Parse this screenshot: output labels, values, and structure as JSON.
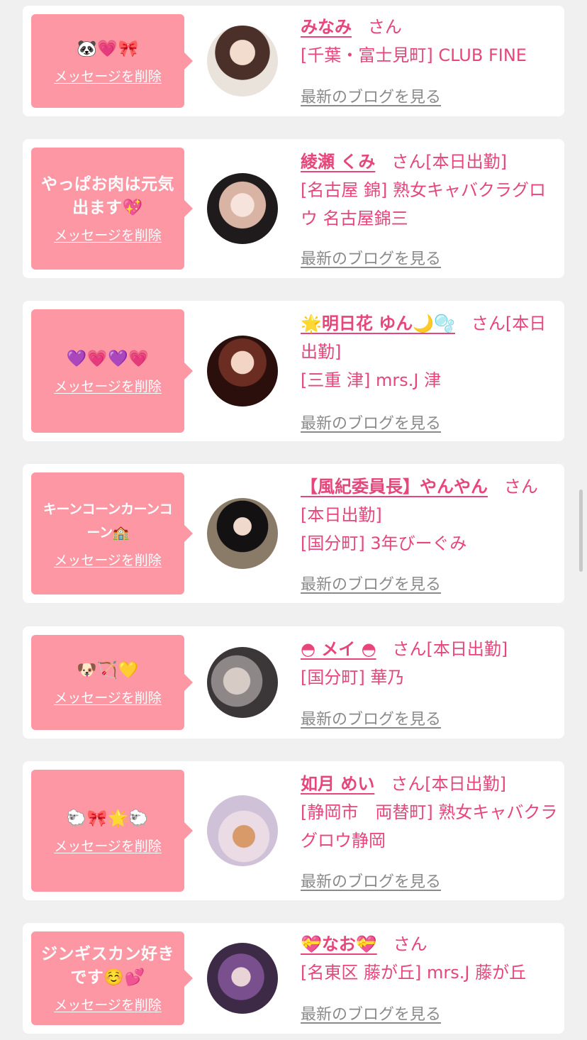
{
  "colors": {
    "bubble": "#fd97a4",
    "accent": "#e6467a",
    "link_gray": "#8a8a8a",
    "background": "#f0f0f0"
  },
  "entries": [
    {
      "message": "🐼💗🎀",
      "delete_label": "メッセージを削除",
      "name": "みなみ",
      "suffix": "さん",
      "status": "",
      "shop": "[千葉・富士見町] CLUB FINE",
      "blog_link": "最新のブログを見る"
    },
    {
      "message": "やっぱお肉は元気出ます💖",
      "delete_label": "メッセージを削除",
      "name": "綾瀬 くみ",
      "suffix": "さん",
      "status": "[本日出勤]",
      "shop": "[名古屋 錦] 熟女キャバクラグロウ 名古屋錦三",
      "blog_link": "最新のブログを見る"
    },
    {
      "message": "💜💗💜💗",
      "delete_label": "メッセージを削除",
      "name": "🌟明日花 ゆん🌙🫧",
      "suffix": "さん",
      "status": "[本日出勤]",
      "shop": "[三重 津] mrs.J 津",
      "blog_link": "最新のブログを見る"
    },
    {
      "message": "キーンコーンカーンコーン🏫",
      "delete_label": "メッセージを削除",
      "name": "【風紀委員長】やんやん",
      "suffix": "さん",
      "status": "[本日出勤]",
      "shop": "[国分町] 3年びーぐみ",
      "blog_link": "最新のブログを見る"
    },
    {
      "message": "🐶🏹💛",
      "delete_label": "メッセージを削除",
      "name": "◓ メイ ◓",
      "suffix": "さん",
      "status": "[本日出勤]",
      "shop": "[国分町] 華乃",
      "blog_link": "最新のブログを見る"
    },
    {
      "message": "🐑🎀🌟🐑",
      "delete_label": "メッセージを削除",
      "name": "如月 めい",
      "suffix": "さん",
      "status": "[本日出勤]",
      "shop": "[静岡市　両替町] 熟女キャバクラ グロウ静岡",
      "blog_link": "最新のブログを見る"
    },
    {
      "message": "ジンギスカン好きです☺️💕",
      "delete_label": "メッセージを削除",
      "name": "💝なお💝",
      "suffix": "さん",
      "status": "",
      "shop": "[名東区 藤が丘] mrs.J 藤が丘",
      "blog_link": "最新のブログを見る"
    }
  ]
}
